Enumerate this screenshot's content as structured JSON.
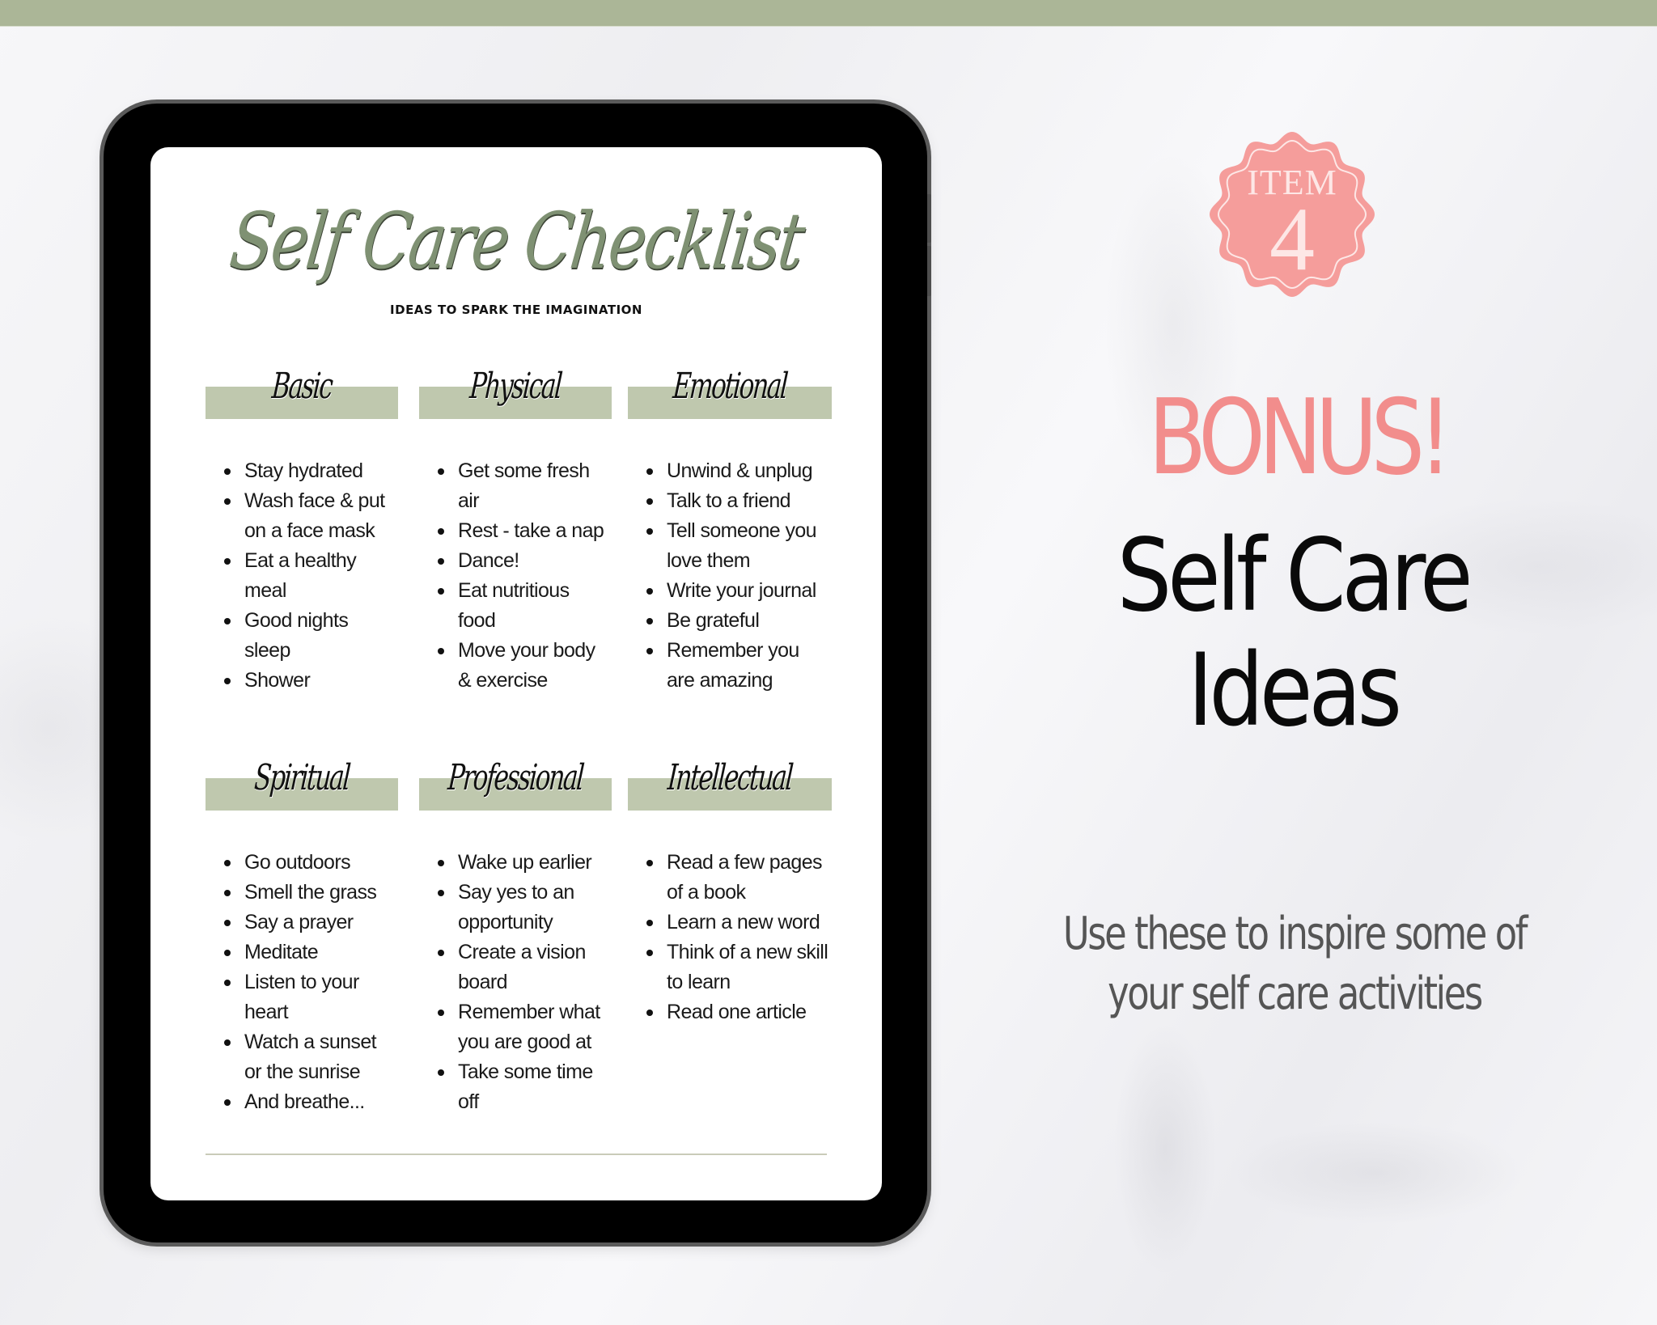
{
  "colors": {
    "top_bar": "#abb697",
    "section_header_bg": "#bfc8ae",
    "title_green": "#7f9173",
    "accent_pink": "#f28d8c",
    "badge_pink": "#f59d9b"
  },
  "document": {
    "title": "Self Care Checklist",
    "subtitle": "IDEAS TO SPARK THE IMAGINATION",
    "sections": [
      {
        "name": "Basic",
        "items": [
          "Stay hydrated",
          "Wash face & put on a face mask",
          "Eat a healthy meal",
          "Good nights sleep",
          "Shower"
        ]
      },
      {
        "name": "Physical",
        "items": [
          "Get some fresh air",
          "Rest - take a nap",
          "Dance!",
          "Eat nutritious food",
          "Move your body & exercise"
        ]
      },
      {
        "name": "Emotional",
        "items": [
          "Unwind & unplug",
          "Talk to a friend",
          "Tell someone you love them",
          "Write your journal",
          "Be grateful",
          "Remember you are amazing"
        ]
      },
      {
        "name": "Spiritual",
        "items": [
          "Go outdoors",
          "Smell the grass",
          "Say a prayer",
          "Meditate",
          "Listen to your heart",
          "Watch a sunset or the sunrise",
          "And breathe..."
        ]
      },
      {
        "name": "Professional",
        "items": [
          "Wake up earlier",
          "Say yes to an opportunity",
          "Create a vision board",
          "Remember what you are good at",
          "Take some time off"
        ]
      },
      {
        "name": "Intellectual",
        "items": [
          "Read a few pages of a book",
          "Learn a new word",
          "Think of a new skill to learn",
          "Read one article"
        ]
      }
    ]
  },
  "badge": {
    "label": "ITEM",
    "number": "4"
  },
  "promo": {
    "bonus": "BONUS!",
    "headline_line1": "Self Care",
    "headline_line2": "Ideas",
    "tagline_line1": "Use these to inspire some of",
    "tagline_line2": "your self care activities"
  }
}
